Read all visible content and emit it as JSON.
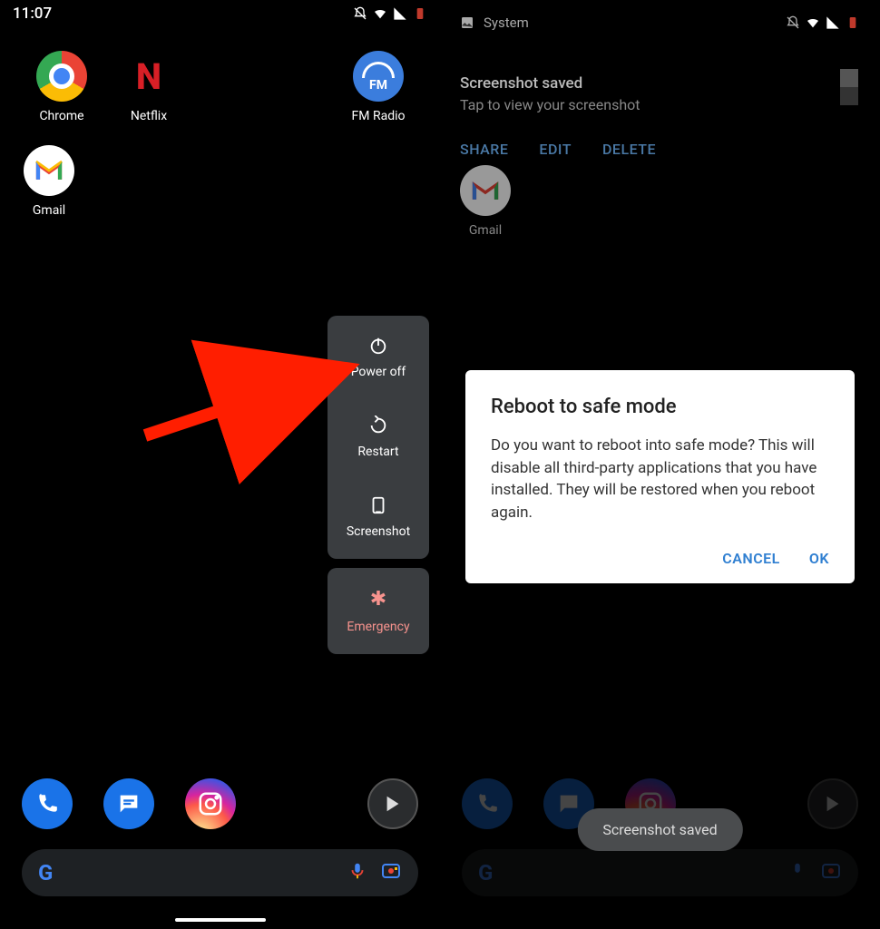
{
  "screen1": {
    "time": "11:07",
    "apps": {
      "chrome": "Chrome",
      "netflix": "Netflix",
      "fmradio": "FM Radio",
      "gmail": "Gmail"
    },
    "power_menu": {
      "power_off": "Power off",
      "restart": "Restart",
      "screenshot": "Screenshot",
      "emergency": "Emergency"
    }
  },
  "screen2": {
    "system_label": "System",
    "notification": {
      "title": "Screenshot saved",
      "subtitle": "Tap to view your screenshot",
      "actions": {
        "share": "SHARE",
        "edit": "EDIT",
        "delete": "DELETE"
      }
    },
    "gmail": "Gmail",
    "dialog": {
      "title": "Reboot to safe mode",
      "body": "Do you want to reboot into safe mode? This will disable all third-party applications that you have installed. They will be restored when you reboot again.",
      "cancel": "CANCEL",
      "ok": "OK"
    },
    "toast": "Screenshot saved"
  }
}
